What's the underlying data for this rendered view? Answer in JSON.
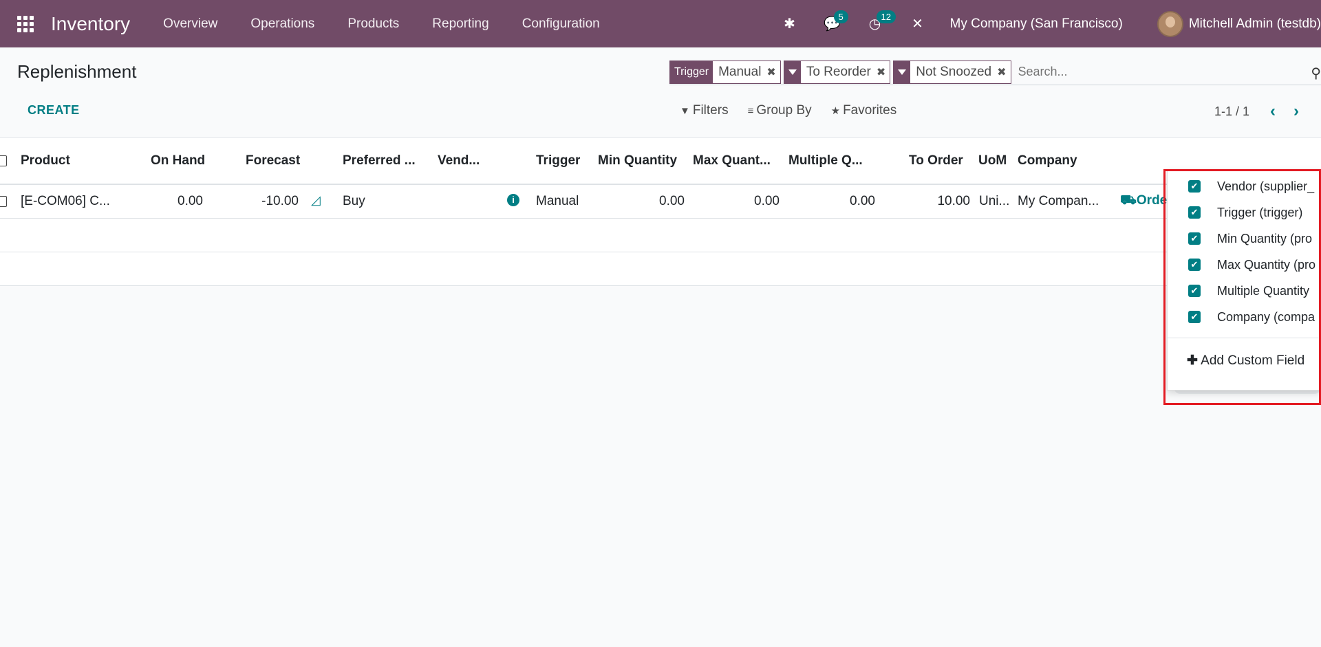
{
  "topbar": {
    "app_name": "Inventory",
    "menu": [
      "Overview",
      "Operations",
      "Products",
      "Reporting",
      "Configuration"
    ],
    "messages_count": "5",
    "activities_count": "12",
    "company": "My Company (San Francisco)",
    "user": "Mitchell Admin (testdb)"
  },
  "page": {
    "title": "Replenishment",
    "create_label": "CREATE"
  },
  "search": {
    "facets": [
      {
        "key": "Trigger",
        "value": "Manual"
      },
      {
        "key": "filter",
        "value": "To Reorder"
      },
      {
        "key": "filter",
        "value": "Not Snoozed"
      }
    ],
    "placeholder": "Search..."
  },
  "controls": {
    "filters": "Filters",
    "group_by": "Group By",
    "favorites": "Favorites",
    "pager": "1-1 / 1"
  },
  "table": {
    "headers": [
      "Product",
      "On Hand",
      "Forecast",
      "Preferred ...",
      "Vend...",
      "Trigger",
      "Min Quantity",
      "Max Quant...",
      "Multiple Q...",
      "To Order",
      "UoM",
      "Company"
    ],
    "row": {
      "product": "[E-COM06] C...",
      "on_hand": "0.00",
      "forecast": "-10.00",
      "preferred_route": "Buy",
      "trigger": "Manual",
      "min_qty": "0.00",
      "max_qty": "0.00",
      "multiple_qty": "0.00",
      "to_order": "10.00",
      "uom": "Uni...",
      "company": "My Compan...",
      "action": "Order"
    }
  },
  "optional_columns": {
    "items": [
      "Vendor (supplier_",
      "Trigger (trigger)",
      "Min Quantity (pro",
      "Max Quantity (pro",
      "Multiple Quantity",
      "Company (compa"
    ],
    "add_custom_field": "Add Custom Field"
  },
  "colors": {
    "brand": "#714B67",
    "accent": "#017e84",
    "highlight": "#e31b23"
  }
}
